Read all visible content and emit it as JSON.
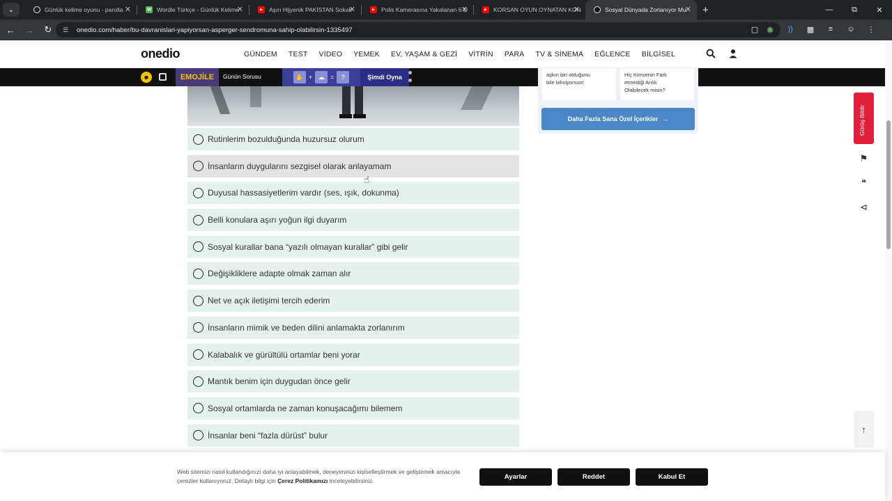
{
  "browser": {
    "tabs": [
      {
        "title": "Günlük kelime oyunu - parolla",
        "favicon": "globe-icon",
        "color": "#e8eaed",
        "active": false
      },
      {
        "title": "Wordle Türkçe - Günlük Kelime",
        "favicon": "w-icon",
        "color": "#4caf50",
        "active": false
      },
      {
        "title": "Aşırı Hijyenik PAKİSTAN Sokak",
        "favicon": "youtube-icon",
        "color": "#ff0000",
        "active": false
      },
      {
        "title": "Polis Kamerasına Yakalanan 6 D",
        "favicon": "youtube-icon",
        "color": "#ff0000",
        "active": false
      },
      {
        "title": "KORSAN OYUN OYNATAN KON",
        "favicon": "youtube-icon",
        "color": "#ff0000",
        "active": false
      },
      {
        "title": "Sosyal Dünyada Zorlanıyor Mu",
        "favicon": "onedio-icon",
        "color": "#111111",
        "active": true
      }
    ],
    "url": "onedio.com/haber/bu-davranislari-yapiyorsan-asperger-sendromuna-sahip-olabilirsin-1335497"
  },
  "site": {
    "logo": "onedio",
    "nav": [
      "GÜNDEM",
      "TEST",
      "VİDEO",
      "YEMEK",
      "EV, YAŞAM & GEZİ",
      "VİTRİN",
      "PARA",
      "TV & SİNEMA",
      "EĞLENCE",
      "BİLGİSEL"
    ],
    "emoji_bar": {
      "brand": "EMOJİLE",
      "question_label": "Günün Sorusu",
      "puzzle": {
        "plus": "+",
        "equals": "=",
        "answer": "?"
      },
      "play_label": "Şimdi Oyna"
    }
  },
  "options": [
    "Rutinlerim bozulduğunda huzursuz olurum",
    "İnsanların duygularını sezgisel olarak anlayamam",
    "Duyusal hassasiyetlerim vardır (ses, ışık, dokunma)",
    "Belli konulara aşırı yoğun ilgi duyarım",
    "Sosyal kurallar bana “yazılı olmayan kurallar” gibi gelir",
    "Değişikliklere adapte olmak zaman alır",
    "Net ve açık iletişimi tercih ederim",
    "İnsanların mimik ve beden dilini anlamakta zorlanırım",
    "Kalabalık ve gürültülü ortamlar beni yorar",
    "Mantık benim için duygudan önce gelir",
    "Sosyal ortamlarda ne zaman konuşacağımı bilemem",
    "İnsanlar beni “fazla dürüst” bulur"
  ],
  "sidebar": {
    "card_left": "aşkın biri olduğunu\nbile bilmiyorsun!",
    "card_right": "Hiç Kimsenin Fark\netmediği Anlık\nOlabilecek misin?",
    "more_button": "Daha Fazla Sana Özel İçerikler"
  },
  "side_tools": {
    "feedback_label": "Görüş Bildir"
  },
  "cookie": {
    "text_before": "Web sitemizi nasıl kullandığınızı daha iyi anlayabilmek, deneyiminizi kişiselleştirmek ve geliştirmek amacıyla çerezler kullanıyoruz. Detaylı bilgi için ",
    "policy_link": "Çerez Politikamızı",
    "text_after": " inceleyebilirsiniz.",
    "buttons": {
      "settings": "Ayarlar",
      "reject": "Reddet",
      "accept": "Kabul Et"
    }
  }
}
